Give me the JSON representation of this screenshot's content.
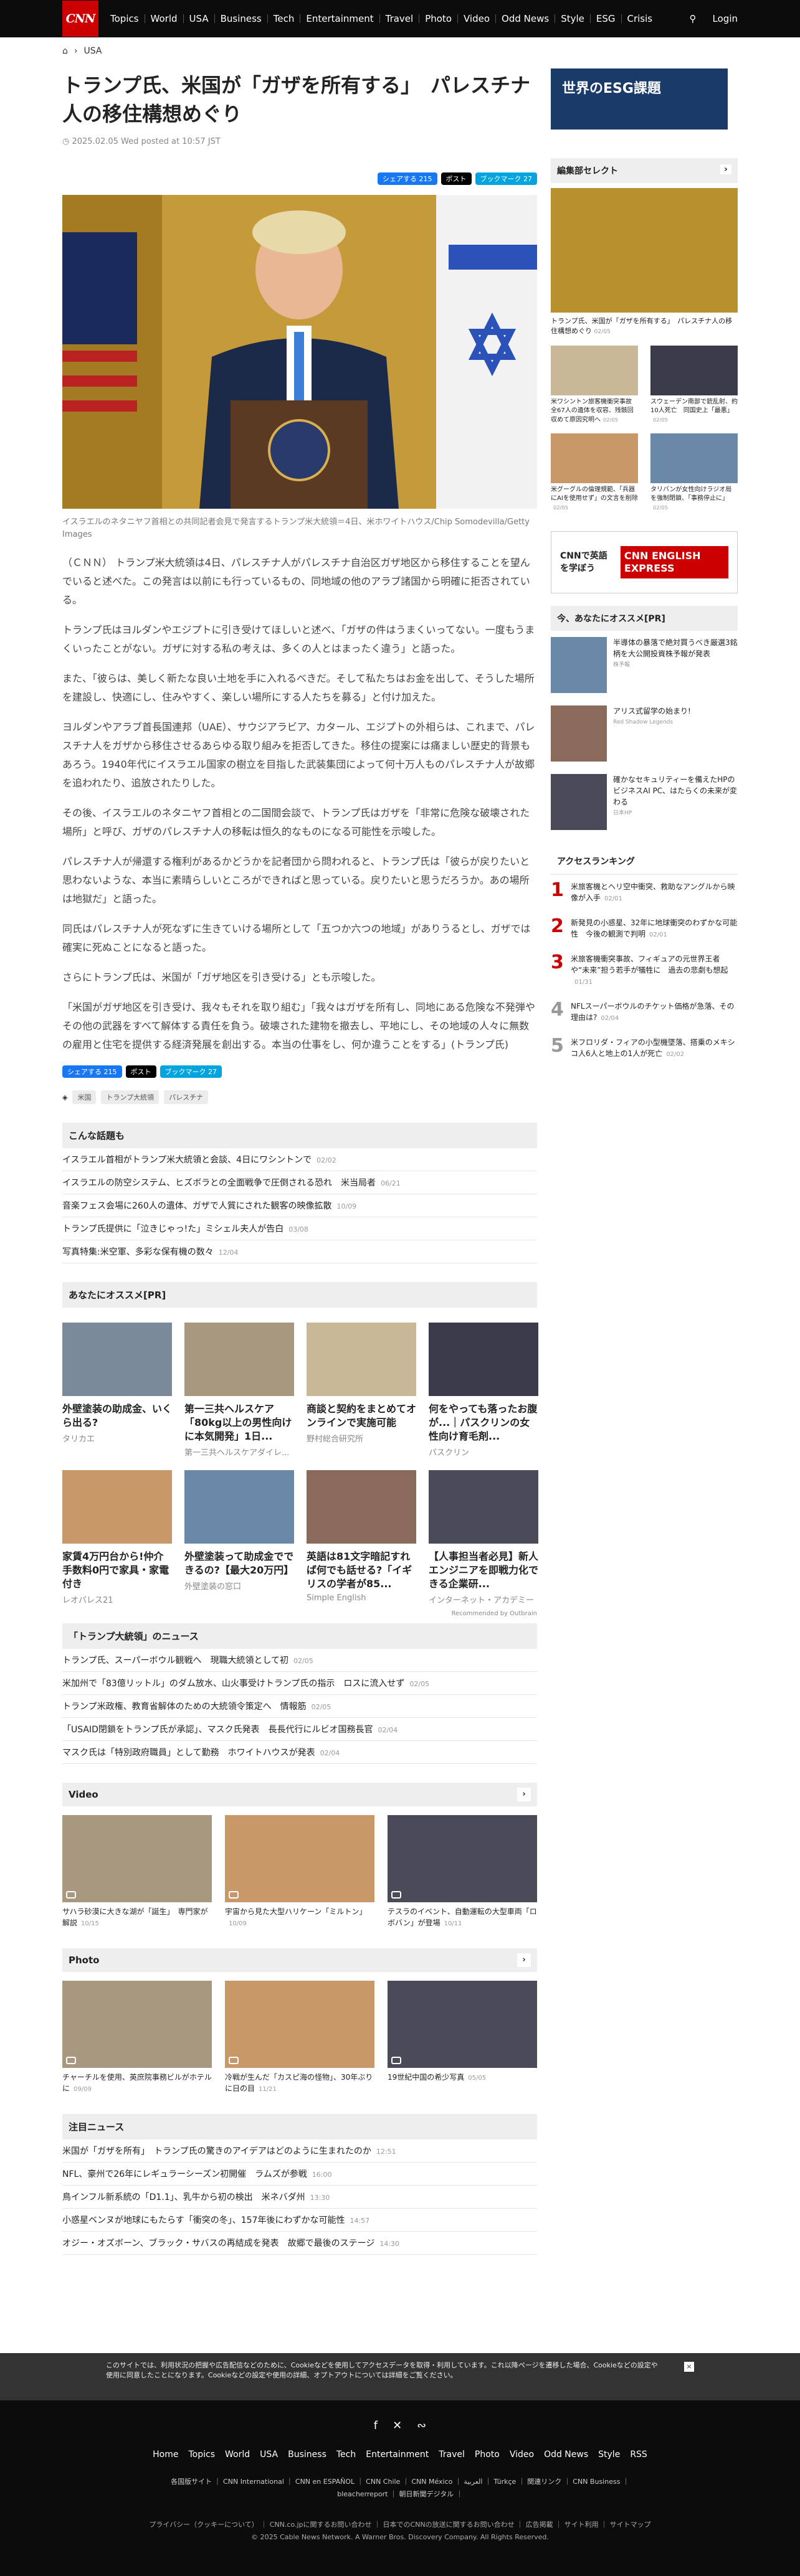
{
  "header": {
    "logo": "CNN",
    "nav": [
      "Topics",
      "World",
      "USA",
      "Business",
      "Tech",
      "Entertainment",
      "Travel",
      "Photo",
      "Video",
      "Odd News",
      "Style",
      "ESG",
      "Crisis"
    ],
    "login": "Login"
  },
  "crumb": "USA",
  "article": {
    "title": "トランプ氏、米国が「ガザを所有する」　パレスチナ人の移住構想めぐり",
    "date": "2025.02.05 Wed posted at 10:57 JST",
    "share_fb": "シェアする 215",
    "share_x": "ポスト",
    "share_hb": "ブックマーク 27",
    "caption": "イスラエルのネタニヤフ首相との共同記者会見で発言するトランプ米大統領＝4日、米ホワイトハウス/Chip Somodevilla/Getty Images",
    "paragraphs": [
      "（ＣＮＮ） トランプ米大統領は4日、パレスチナ人がパレスチナ自治区ガザ地区から移住することを望んでいると述べた。この発言は以前にも行っているもの、同地域の他のアラブ諸国から明確に拒否されている。",
      "トランプ氏はヨルダンやエジプトに引き受けてほしいと述べ、「ガザの件はうまくいってない。一度もうまくいったことがない。ガザに対する私の考えは、多くの人とはまったく違う」と語った。",
      "また、「彼らは、美しく新たな良い土地を手に入れるべきだ。そして私たちはお金を出して、そうした場所を建設し、快適にし、住みやすく、楽しい場所にする人たちを募る」と付け加えた。",
      "ヨルダンやアラブ首長国連邦（UAE）、サウジアラビア、カタール、エジプトの外相らは、これまで、パレスチナ人をガザから移住させるあらゆる取り組みを拒否してきた。移住の提案には痛ましい歴史的背景もあろう。1940年代にイスラエル国家の樹立を目指した武装集団によって何十万人ものパレスチナ人が故郷を追われたり、追放されたりした。",
      "その後、イスラエルのネタニヤフ首相との二国間会談で、トランプ氏はガザを「非常に危険な破壊された場所」と呼び、ガザのパレスチナ人の移転は恒久的なものになる可能性を示唆した。",
      "パレスチナ人が帰還する権利があるかどうかを記者団から問われると、トランプ氏は「彼らが戻りたいと思わないような、本当に素晴らしいところができればと思っている。戻りたいと思うだろうか。あの場所は地獄だ」と語った。",
      "同氏はパレスチナ人が死なずに生きていける場所として「五つか六つの地域」がありうるとし、ガザでは確実に死ぬことになると語った。",
      "さらにトランプ氏は、米国が「ガザ地区を引き受ける」とも示唆した。",
      "「米国がガザ地区を引き受け、我々もそれを取り組む」「我々はガザを所有し、同地にある危険な不発弾やその他の武器をすべて解体する責任を負う。破壊された建物を撤去し、平地にし、その地域の人々に無数の雇用と住宅を提供する経済発展を創出する。本当の仕事をし、何か違うことをする」(トランプ氏)"
    ],
    "tags": [
      "米国",
      "トランプ大統領",
      "パレスチナ"
    ]
  },
  "related": {
    "title": "こんな話題も",
    "items": [
      {
        "t": "イスラエル首相がトランプ米大統領と会談、4日にワシントンで",
        "d": "02/02"
      },
      {
        "t": "イスラエルの防空システム、ヒズボラとの全面戦争で圧倒される恐れ　米当局者",
        "d": "06/21"
      },
      {
        "t": "音楽フェス会場に260人の遺体、ガザで人質にされた観客の映像拡散",
        "d": "10/09"
      },
      {
        "t": "トランプ氏提供に「泣きじゃっ!た」ミシェル夫人が告白",
        "d": "03/08"
      },
      {
        "t": "写真特集:米空軍、多彩な保有機の数々",
        "d": "12/04"
      }
    ]
  },
  "pr": {
    "title": "あなたにオススメ[PR]",
    "cards": [
      {
        "t": "外壁塗装の助成金、いくら出る?",
        "s": "タリカエ"
      },
      {
        "t": "第一三共ヘルスケア「80kg以上の男性向けに本気開発」1日...",
        "s": "第一三共ヘルスケアダイレ..."
      },
      {
        "t": "商談と契約をまとめてオンラインで実施可能",
        "s": "野村総合研究所"
      },
      {
        "t": "何をやっても落ったお腹が...｜パスクリンの女性向け育毛剤...",
        "s": "パスクリン"
      },
      {
        "t": "家賃4万円台から!仲介手数料0円で家具・家電付き",
        "s": "レオパレス21"
      },
      {
        "t": "外壁塗装って助成金でできるの?【最大20万円】",
        "s": "外壁塗装の窓口"
      },
      {
        "t": "英語は81文字暗記すれば何でも話せる?「イギリスの学者が85...",
        "s": "Simple English"
      },
      {
        "t": "【人事担当者必見】新人エンジニアを即戦力化できる企業研...",
        "s": "インターネット・アカデミー"
      }
    ],
    "outbrain": "Recommended by Outbrain"
  },
  "trump": {
    "title": "「トランプ大統領」のニュース",
    "items": [
      {
        "t": "トランプ氏、スーパーボウル観戦へ　現職大統領として初",
        "d": "02/05"
      },
      {
        "t": "米加州で「83億リットル」のダム放水、山火事受けトランプ氏の指示　ロスに流入せず",
        "d": "02/05"
      },
      {
        "t": "トランプ米政権、教育省解体のための大統領令策定へ　情報筋",
        "d": "02/05"
      },
      {
        "t": "「USAID閉鎖をトランプ氏が承認」、マスク氏発表　長長代行にルビオ国務長官",
        "d": "02/04"
      },
      {
        "t": "マスク氏は「特別政府職員」として勤務　ホワイトハウスが発表",
        "d": "02/04"
      }
    ]
  },
  "video": {
    "title": "Video",
    "items": [
      {
        "t": "サハラ砂漠に大きな湖が「誕生」　専門家が解説",
        "d": "10/15"
      },
      {
        "t": "宇宙から見た大型ハリケーン「ミルトン」",
        "d": "10/09"
      },
      {
        "t": "テスラのイベント、自動運転の大型車両「ロボバン」が登場",
        "d": "10/11"
      }
    ]
  },
  "photo": {
    "title": "Photo",
    "items": [
      {
        "t": "チャーチルを使用、英庶院事務ビルがホテルに",
        "d": "09/09"
      },
      {
        "t": "冷戦が生んだ「カスピ海の怪物」、30年ぶりに日の目",
        "d": "11/21"
      },
      {
        "t": "19世紀中国の希少写真",
        "d": "05/05"
      }
    ]
  },
  "hot": {
    "title": "注目ニュース",
    "items": [
      {
        "t": "米国が「ガザを所有」　トランプ氏の驚きのアイデアはどのように生まれたのか",
        "d": "12:51"
      },
      {
        "t": "NFL、豪州で26年にレギュラーシーズン初開催　ラムズが参戦",
        "d": "16:00"
      },
      {
        "t": "鳥インフル新系統の「D1.1」、乳牛から初の検出　米ネバダ州",
        "d": "13:30"
      },
      {
        "t": "小惑星ベンヌが地球にもたらす「衝突の冬」、157年後にわずかな可能性",
        "d": "14:57"
      },
      {
        "t": "オジー・オズボーン、ブラック・サバスの再結成を発表　故郷で最後のステージ",
        "d": "14:30"
      }
    ]
  },
  "side": {
    "esg_title": "世界のESG課題",
    "editor": "編集部セレクト",
    "ed_main": {
      "t": "トランプ氏、米国が「ガザを所有する」　パレスチナ人の移住構想めぐり",
      "d": "02/05"
    },
    "ed_items": [
      {
        "t": "米ワシントン旅客機衝突事故　全67人の遺体を収容、残骸回収めて原因究明へ",
        "d": "02/05"
      },
      {
        "t": "スウェーデン南部で銃乱射、約10人死亡　同国史上「最悪」",
        "d": "02/05"
      },
      {
        "t": "米グーグルの倫理規範、「兵器にAIを使用せず」の文言を削除",
        "d": "02/05"
      },
      {
        "t": "タリバンが女性向けラジオ局を強制閉鎖、「事務停止に」",
        "d": "02/05"
      }
    ],
    "english": "CNNで英語を学ぼう",
    "english_brand": "CNN ENGLISH EXPRESS",
    "pr_title": "今、あなたにオススメ[PR]",
    "pr_items": [
      {
        "t": "半導体の暴落で絶対買うべき厳選3銘柄を大公開投資株予報が発表",
        "s": "株予報"
      },
      {
        "t": "アリス式留学の始まり!",
        "s": "Red Shadow Legends"
      },
      {
        "t": "確かなセキュリティーを備えたHPのビジネスAI PC、はたらくの未来が変わる",
        "s": "日本HP"
      }
    ],
    "rank_title": "アクセスランキング",
    "rank": [
      {
        "t": "米旅客機とヘリ空中衝突、救助なアングルから映像が入手",
        "d": "02/01"
      },
      {
        "t": "新発見の小惑星、32年に地球衝突のわずかな可能性　今後の観測で判明",
        "d": "02/01"
      },
      {
        "t": "米旅客機衝突事故、フィギュアの元世界王者や“未来”担う若手が犠牲に　過去の悲劇も想起",
        "d": "01/31"
      },
      {
        "t": "NFLスーパーボウルのチケット価格が急落、その理由は?",
        "d": "02/04"
      },
      {
        "t": "米フロリダ・フィアの小型機墜落、搭乗のメキシコ人6人と地上の1人が死亡",
        "d": "02/02"
      }
    ]
  },
  "cookie": "このサイトでは、利用状況の把握や広告配信などのために、Cookieなどを使用してアクセスデータを取得・利用しています。これ以降ページを遷移した場合、Cookieなどの設定や使用に同意したことになります。Cookieなどの設定や使用の詳細、オプトアウトについては詳細をご覧ください。",
  "footer": {
    "nav": [
      "Home",
      "Topics",
      "World",
      "USA",
      "Business",
      "Tech",
      "Entertainment",
      "Travel",
      "Photo",
      "Video",
      "Odd News",
      "Style",
      "RSS"
    ],
    "links": "各国版サイト ｜ CNN International ｜ CNN en ESPAÑOL ｜ CNN Chile ｜ CNN México ｜ العربية ｜ Türkçe ｜ 関連リンク ｜ CNN Business ｜ bleacherreport ｜ 朝日新聞デジタル ｜",
    "bottom": "プライバシー（クッキーについて） ｜ CNN.co.jpに関するお問い合わせ ｜ 日本でのCNNの放送に関するお問い合わせ ｜ 広告掲載 ｜ サイト利用 ｜ サイトマップ",
    "copy": "© 2025 Cable News Network. A Warner Bros. Discovery Company. All Rights Reserved."
  }
}
